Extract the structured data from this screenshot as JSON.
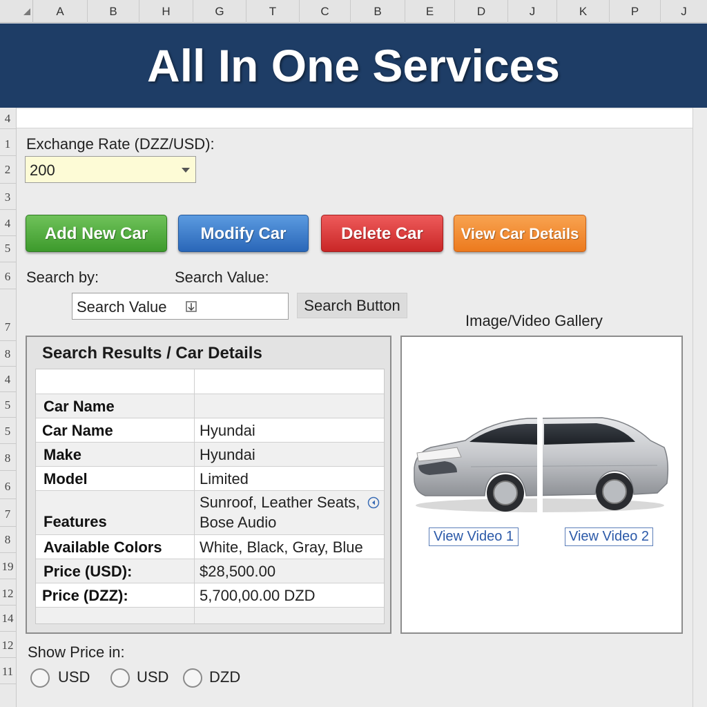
{
  "columns": [
    "A",
    "B",
    "H",
    "G",
    "T",
    "C",
    "B",
    "E",
    "D",
    "J",
    "K",
    "P",
    "J"
  ],
  "rows": [
    "4",
    "1",
    "2",
    "3",
    "4",
    "5",
    "6",
    "7",
    "8",
    "4",
    "5",
    "5",
    "8",
    "6",
    "7",
    "8",
    "19",
    "12",
    "14",
    "12",
    "11"
  ],
  "banner": {
    "title": "All In One Services",
    "color": "#1e3d66"
  },
  "exchange": {
    "label": "Exchange Rate (DZZ/USD):",
    "value": "200"
  },
  "actions": {
    "add": "Add New Car",
    "modify": "Modify Car",
    "delete": "Delete Car",
    "view": "View Car Details"
  },
  "search": {
    "by_label": "Search by:",
    "value_label": "Search Value:",
    "input_value": "Search Value",
    "button": "Search Button"
  },
  "results": {
    "title": "Search Results / Car Details",
    "rows": [
      {
        "label": "",
        "value": ""
      },
      {
        "label": "Car Name",
        "value": ""
      },
      {
        "label": "Car Name",
        "value": "Hyundai"
      },
      {
        "label": "Make",
        "value": "Hyundai"
      },
      {
        "label": "Model",
        "value": "Limited"
      },
      {
        "label": "Features",
        "value": "Sunroof, Leather Seats,",
        "value2": "Bose Audio"
      },
      {
        "label": "Available Colors",
        "value": "White, Black, Gray, Blue"
      },
      {
        "label": "Price (USD):",
        "value": "$28,500.00"
      },
      {
        "label": "Price (DZZ):",
        "value": "5,700,00.00 DZD"
      },
      {
        "label": "",
        "value": ""
      }
    ]
  },
  "gallery": {
    "title": "Image/Video Gallery",
    "video1": "View Video 1",
    "video2": "View Video 2"
  },
  "price_toggle": {
    "label": "Show Price in:",
    "options": [
      "USD",
      "USD",
      "DZD"
    ]
  }
}
